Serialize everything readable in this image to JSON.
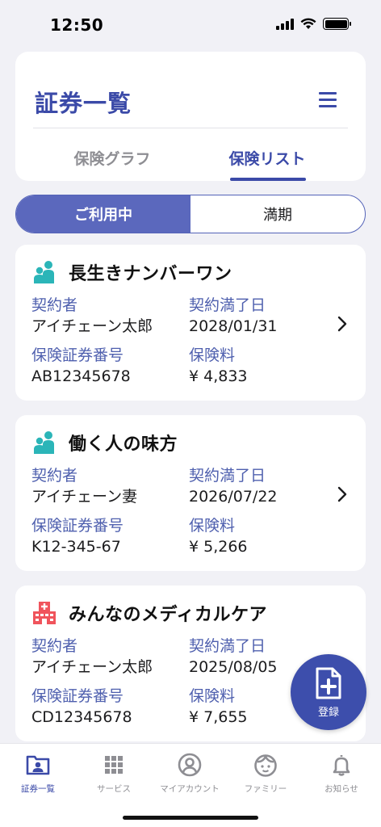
{
  "status_bar": {
    "time": "12:50"
  },
  "header": {
    "title": "証券一覧",
    "tabs": [
      {
        "label": "保険グラフ",
        "active": false
      },
      {
        "label": "保険リスト",
        "active": true
      }
    ]
  },
  "segment": {
    "options": [
      {
        "label": "ご利用中",
        "active": true
      },
      {
        "label": "満期",
        "active": false
      }
    ]
  },
  "policies": [
    {
      "icon": "family-icon",
      "icon_color": "#2bb5b8",
      "name": "長生きナンバーワン",
      "contractor_label": "契約者",
      "contractor": "アイチェーン太郎",
      "expiry_label": "契約満了日",
      "expiry": "2028/01/31",
      "number_label": "保険証券番号",
      "number": "AB12345678",
      "premium_label": "保険料",
      "premium": "¥ 4,833"
    },
    {
      "icon": "family-icon",
      "icon_color": "#2bb5b8",
      "name": "働く人の味方",
      "contractor_label": "契約者",
      "contractor": "アイチェーン妻",
      "expiry_label": "契約満了日",
      "expiry": "2026/07/22",
      "number_label": "保険証券番号",
      "number": "K12-345-67",
      "premium_label": "保険料",
      "premium": "¥ 5,266"
    },
    {
      "icon": "hospital-icon",
      "icon_color": "#f0545c",
      "name": "みんなのメディカルケア",
      "contractor_label": "契約者",
      "contractor": "アイチェーン太郎",
      "expiry_label": "契約満了日",
      "expiry": "2025/08/05",
      "number_label": "保険証券番号",
      "number": "CD12345678",
      "premium_label": "保険料",
      "premium": "¥ 7,655"
    }
  ],
  "fab": {
    "label": "登録",
    "icon": "add-document-icon"
  },
  "tabbar": {
    "items": [
      {
        "label": "証券一覧",
        "icon": "policy-card-icon",
        "active": true
      },
      {
        "label": "サービス",
        "icon": "grid-icon",
        "active": false
      },
      {
        "label": "マイアカウント",
        "icon": "account-icon",
        "active": false
      },
      {
        "label": "ファミリー",
        "icon": "family-face-icon",
        "active": false
      },
      {
        "label": "お知らせ",
        "icon": "bell-icon",
        "active": false
      }
    ]
  },
  "colors": {
    "accent": "#3b4aa8",
    "segment_active": "#5b68bd",
    "label": "#4e5fae"
  }
}
